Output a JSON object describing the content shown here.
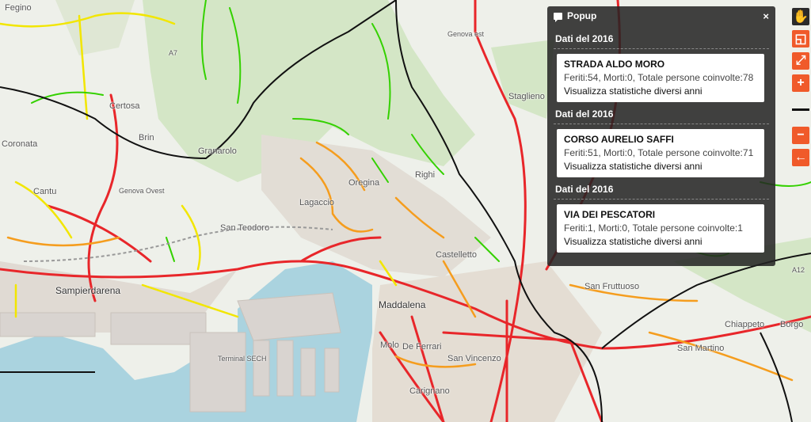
{
  "map": {
    "places": [
      {
        "name": "Fegino"
      },
      {
        "name": "Coronata"
      },
      {
        "name": "Certosa"
      },
      {
        "name": "Brin"
      },
      {
        "name": "Granarolo"
      },
      {
        "name": "Cantu"
      },
      {
        "name": "Lagaccio"
      },
      {
        "name": "San Teodoro"
      },
      {
        "name": "Oregina"
      },
      {
        "name": "Righi"
      },
      {
        "name": "Castelletto"
      },
      {
        "name": "Sampierdarena"
      },
      {
        "name": "Maddalena"
      },
      {
        "name": "Molo"
      },
      {
        "name": "De Ferrari"
      },
      {
        "name": "San Vincenzo"
      },
      {
        "name": "Carignano"
      },
      {
        "name": "San Fruttuoso"
      },
      {
        "name": "Chiappeto"
      },
      {
        "name": "Borgo"
      },
      {
        "name": "San Martino"
      },
      {
        "name": "Staglieno"
      },
      {
        "name": "Genova est"
      },
      {
        "name": "Genova Ovest"
      },
      {
        "name": "Terminal SECH"
      },
      {
        "name": "A7"
      },
      {
        "name": "A12"
      }
    ]
  },
  "popup": {
    "title": "Popup",
    "close_label": "×",
    "sections": [
      {
        "header": "Dati del 2016",
        "street": "STRADA ALDO MORO",
        "stats": "Feriti:54, Morti:0, Totale persone coinvolte:78",
        "link": "Visualizza statistiche diversi anni"
      },
      {
        "header": "Dati del 2016",
        "street": "CORSO AURELIO SAFFI",
        "stats": "Feriti:51, Morti:0, Totale persone coinvolte:71",
        "link": "Visualizza statistiche diversi anni"
      },
      {
        "header": "Dati del 2016",
        "street": "VIA DEI PESCATORI",
        "stats": "Feriti:1, Morti:0, Totale persone coinvolte:1",
        "link": "Visualizza statistiche diversi anni"
      }
    ]
  },
  "toolbar": {
    "items": [
      {
        "icon": "hand-pan-icon",
        "glyph": "✋"
      },
      {
        "icon": "select-box-icon",
        "glyph": "◱"
      },
      {
        "icon": "zoom-extent-icon",
        "glyph": "⤢"
      },
      {
        "icon": "zoom-in-icon",
        "glyph": "+"
      },
      {
        "icon": "zoom-out-icon",
        "glyph": "−"
      },
      {
        "icon": "back-arrow-icon",
        "glyph": "←"
      }
    ]
  },
  "colors": {
    "sea": "#aad3df",
    "land": "#eef0ea",
    "green_area": "#cfe3c2",
    "road_red": "#e8262a",
    "road_orange": "#f59d1e",
    "road_yellow": "#f2e600",
    "road_green": "#34d100",
    "boundary": "#111111",
    "popup_bg": "#232323",
    "toolbar_orange": "#f05a2a"
  }
}
